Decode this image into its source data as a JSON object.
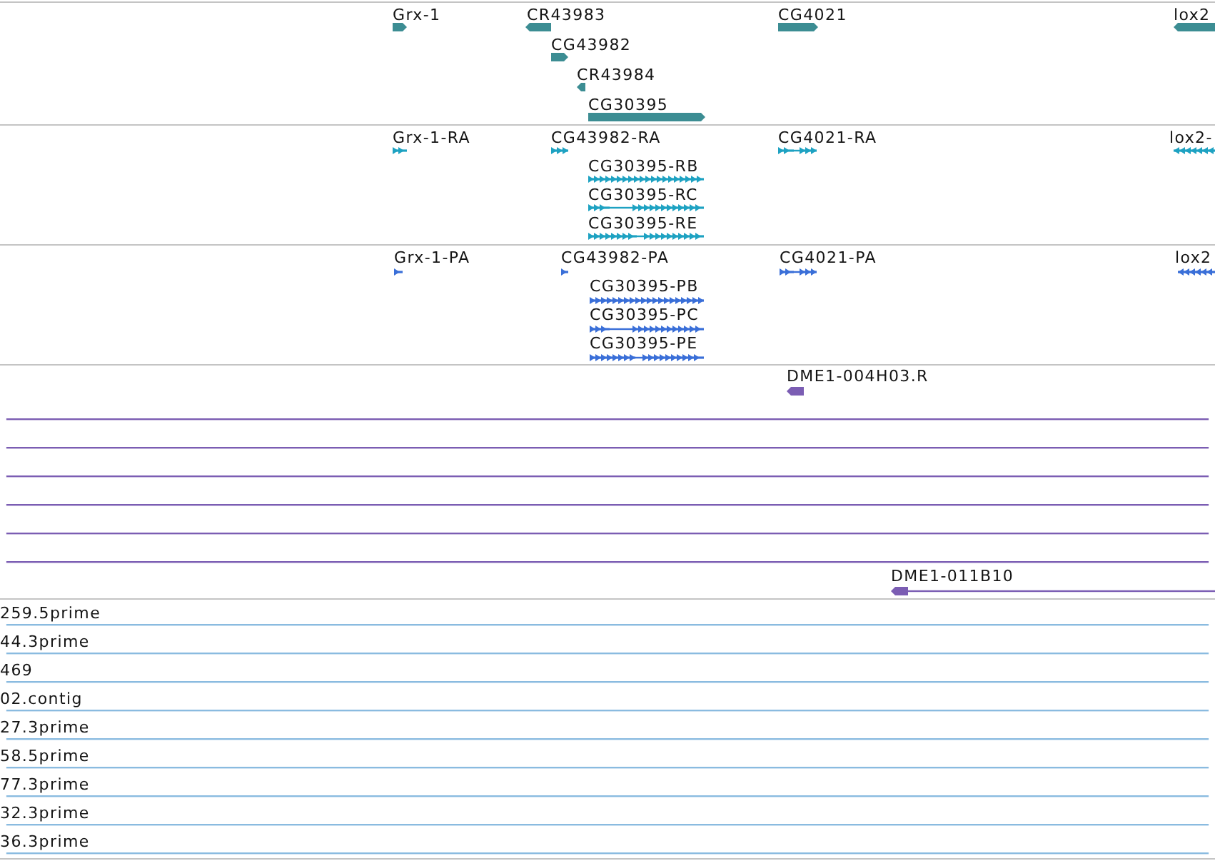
{
  "tracks": [
    {
      "color": "#3c8d93",
      "features": [
        {
          "label": "Grx-1",
          "kind": "gene",
          "reverse": false
        },
        {
          "label": "CR43983",
          "kind": "gene",
          "reverse": true
        },
        {
          "label": "CG4021",
          "kind": "gene",
          "reverse": false
        },
        {
          "label": "lox2",
          "kind": "gene",
          "reverse": true
        },
        {
          "label": "CG43982",
          "kind": "gene",
          "reverse": false
        },
        {
          "label": "CR43984",
          "kind": "gene",
          "reverse": true
        },
        {
          "label": "CG30395",
          "kind": "gene",
          "reverse": false
        }
      ]
    },
    {
      "color": "#1ea2c2",
      "features": [
        {
          "label": "Grx-1-RA",
          "kind": "transcript",
          "reverse": false
        },
        {
          "label": "CG43982-RA",
          "kind": "transcript",
          "reverse": false
        },
        {
          "label": "CG4021-RA",
          "kind": "transcript",
          "reverse": false
        },
        {
          "label": "lox2-",
          "kind": "transcript",
          "reverse": true
        },
        {
          "label": "CG30395-RB",
          "kind": "transcript",
          "reverse": false
        },
        {
          "label": "CG30395-RC",
          "kind": "transcript",
          "reverse": false
        },
        {
          "label": "CG30395-RE",
          "kind": "transcript",
          "reverse": false
        }
      ]
    },
    {
      "color": "#3a6fd8",
      "features": [
        {
          "label": "Grx-1-PA",
          "kind": "protein",
          "reverse": false
        },
        {
          "label": "CG43982-PA",
          "kind": "protein",
          "reverse": false
        },
        {
          "label": "CG4021-PA",
          "kind": "protein",
          "reverse": false
        },
        {
          "label": "lox2",
          "kind": "protein",
          "reverse": true
        },
        {
          "label": "CG30395-PB",
          "kind": "protein",
          "reverse": false
        },
        {
          "label": "CG30395-PC",
          "kind": "protein",
          "reverse": false
        },
        {
          "label": "CG30395-PE",
          "kind": "protein",
          "reverse": false
        }
      ]
    },
    {
      "color": "#7b5db3",
      "features": [
        {
          "label": "DME1-004H03.R",
          "kind": "read",
          "reverse": true
        },
        {
          "kind": "span"
        },
        {
          "kind": "span"
        },
        {
          "kind": "span"
        },
        {
          "kind": "span"
        },
        {
          "kind": "span"
        },
        {
          "kind": "span"
        },
        {
          "label": "DME1-011B10",
          "kind": "read",
          "reverse": true
        }
      ]
    },
    {
      "color": "#8abbe0",
      "features": [
        {
          "label": "259.5prime",
          "kind": "span"
        },
        {
          "label": "44.3prime",
          "kind": "span"
        },
        {
          "label": "469",
          "kind": "span"
        },
        {
          "label": "02.contig",
          "kind": "span"
        },
        {
          "label": "27.3prime",
          "kind": "span"
        },
        {
          "label": "58.5prime",
          "kind": "span"
        },
        {
          "label": "77.3prime",
          "kind": "span"
        },
        {
          "label": "32.3prime",
          "kind": "span"
        },
        {
          "label": "36.3prime",
          "kind": "span"
        }
      ]
    }
  ]
}
